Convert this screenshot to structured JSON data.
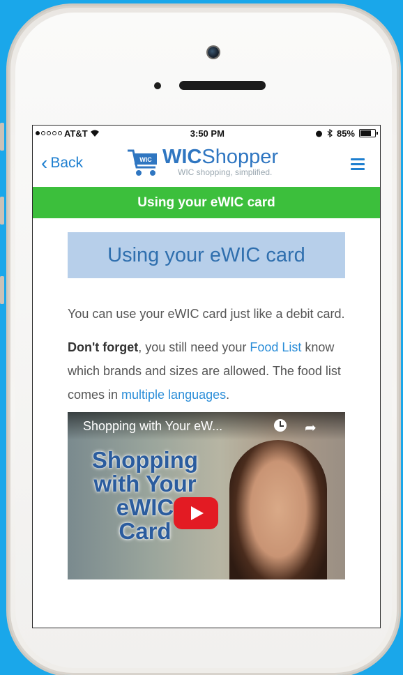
{
  "status_bar": {
    "carrier": "AT&T",
    "time": "3:50 PM",
    "battery": "85%",
    "battery_level": 0.85
  },
  "app_bar": {
    "back_label": "Back",
    "logo_bold": "WIC",
    "logo_light": "Shopper",
    "tagline": "WIC shopping, simplified."
  },
  "green_bar": {
    "title": "Using your eWIC card"
  },
  "main": {
    "heading": "Using your eWIC card",
    "para1": "You can use your eWIC card just like a debit card.",
    "para2_bold": "Don't forget",
    "para2_a": ", you still need your ",
    "link_food_list": "Food List",
    "para2_b": " know which brands and sizes are allowed. The food list comes in ",
    "link_languages": "multiple languages",
    "para2_c": "."
  },
  "video": {
    "title": "Shopping with Your eW...",
    "overlay_lines": [
      "Shopping",
      "with Your",
      "eWIC",
      "Card"
    ]
  },
  "colors": {
    "page_bg": "#1aa7ea",
    "brand_blue": "#2f76c1",
    "green_bar": "#3cbf3c",
    "link": "#2a8dd8",
    "heading_bg": "#b7cfea"
  }
}
